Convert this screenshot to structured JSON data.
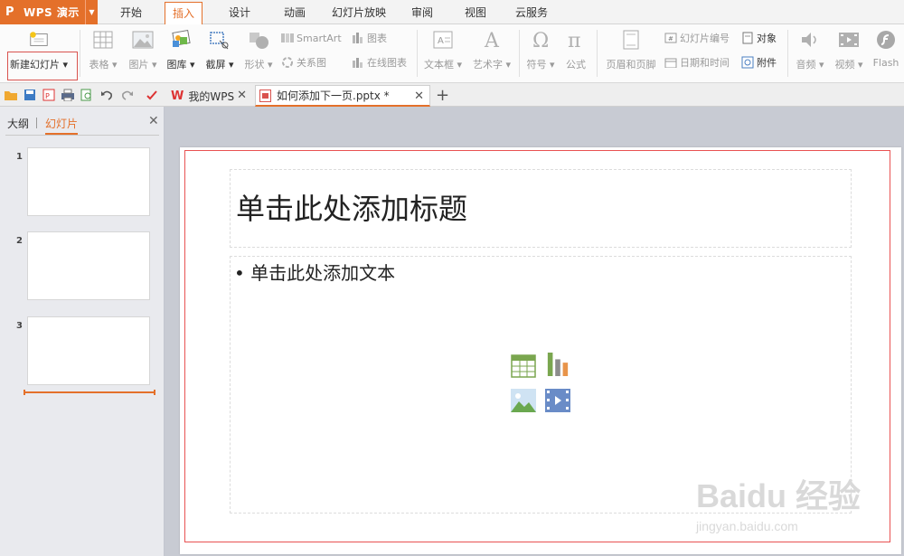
{
  "app": {
    "name": "WPS 演示"
  },
  "menu": [
    "开始",
    "插入",
    "设计",
    "动画",
    "幻灯片放映",
    "审阅",
    "视图",
    "云服务"
  ],
  "ribbon": {
    "new_slide": "新建幻灯片",
    "table": "表格",
    "picture": "图片",
    "gallery": "图库",
    "screenshot": "截屏",
    "shape": "形状",
    "smartart": "SmartArt",
    "relation": "关系图",
    "chart": "图表",
    "online_chart": "在线图表",
    "textbox": "文本框",
    "wordart": "艺术字",
    "symbol": "符号",
    "formula": "公式",
    "header_footer": "页眉和页脚",
    "slide_number": "幻灯片编号",
    "date_time": "日期和时间",
    "object": "对象",
    "attachment": "附件",
    "audio": "音频",
    "video": "视频",
    "flash": "Flash"
  },
  "doc_tabs": [
    {
      "label": "我的WPS"
    },
    {
      "label": "如何添加下一页.pptx *"
    }
  ],
  "left_pane": {
    "tab_outline": "大纲",
    "tab_slides": "幻灯片",
    "slide_numbers": [
      "1",
      "2",
      "3"
    ]
  },
  "slide": {
    "title_placeholder": "单击此处添加标题",
    "body_placeholder": "• 单击此处添加文本"
  },
  "watermark": {
    "main": "Baidu 经验",
    "sub": "jingyan.baidu.com"
  },
  "colors": {
    "accent": "#e4702a",
    "highlight_border": "#d9534f"
  }
}
